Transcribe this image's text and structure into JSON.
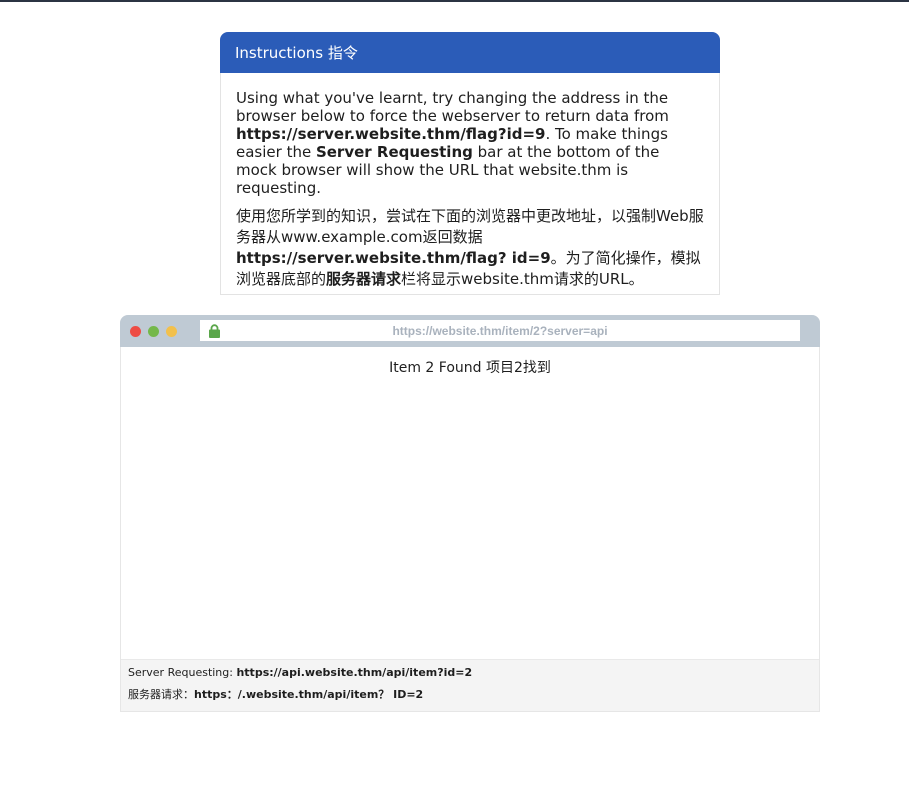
{
  "instructions": {
    "title": "Instructions  指令",
    "en": {
      "part1": "Using what you've learnt, try changing the address in the browser below to force the webserver to return data from ",
      "flag_url": "https://server.website.thm/flag?id=9",
      "part2": ". To make things easier the ",
      "bar_name": "Server Requesting",
      "part3": " bar at the bottom of the mock browser will show the URL that website.thm is requesting."
    },
    "zh": {
      "part1": "使用您所学到的知识，尝试在下面的浏览器中更改地址，以强制Web服务器从www.example.com返回数据",
      "flag_url": "https://server.website.thm/flag? id=9",
      "part2": "。为了简化操作，模拟浏览器底部的",
      "bar_name": "服务器请求",
      "part3": "栏将显示website.thm请求的URL。"
    }
  },
  "browser": {
    "address": "https://website.thm/item/2?server=api",
    "content": "Item 2 Found  项目2找到",
    "status": {
      "en_label": "Server Requesting: ",
      "en_url": "https://api.website.thm/api/item?id=2",
      "zh_label": "服务器请求：",
      "zh_url": "https：/.website.thm/api/item？ ID=2"
    },
    "colors": {
      "bar": "#bfcad4",
      "dot_red": "#ee4c44",
      "dot_green": "#74b84a",
      "dot_yellow": "#f2c04c",
      "lock": "#5aa64a"
    }
  },
  "colors": {
    "header": "#2b5cb8",
    "top_rule": "#2b3443"
  },
  "icons": [
    "lock-icon",
    "window-close-dot",
    "window-maximize-dot",
    "window-minimize-dot"
  ]
}
